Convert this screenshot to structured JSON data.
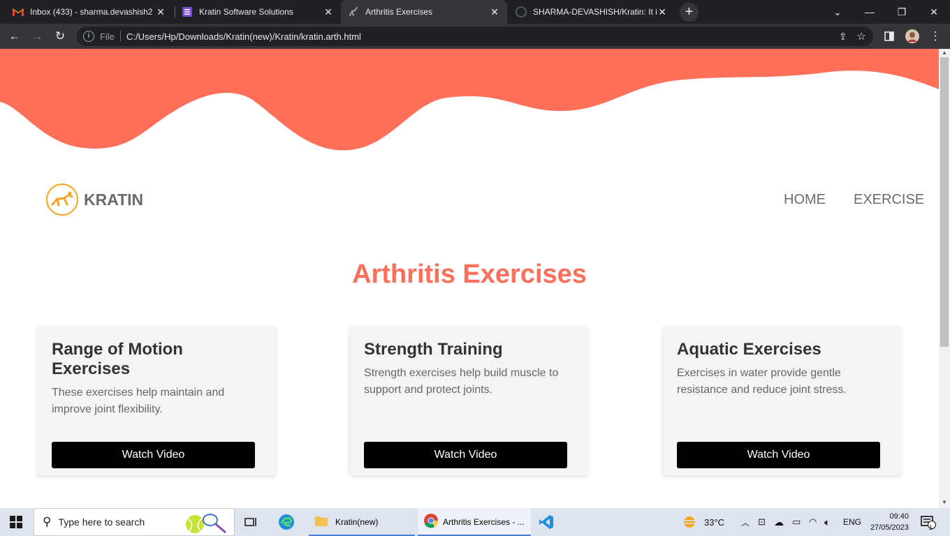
{
  "browser": {
    "tabs": [
      {
        "title": "Inbox (433) - sharma.devashish2",
        "icon": "gmail-icon"
      },
      {
        "title": "Kratin Software Solutions",
        "icon": "doc-icon"
      },
      {
        "title": "Arthritis Exercises",
        "icon": "exercise-icon",
        "active": true
      },
      {
        "title": "SHARMA-DEVASHISH/Kratin: It is",
        "icon": "github-icon"
      }
    ],
    "new_tab": "+",
    "omnibox": {
      "scheme_label": "File",
      "url": "C:/Users/Hp/Downloads/Kratin(new)/Kratin/kratin.arth.html"
    }
  },
  "site": {
    "logo_text": "KRATIN",
    "nav": {
      "home": "HOME",
      "exercise": "EXERCISE"
    },
    "title": "Arthritis Exercises",
    "accent_color": "#ff6f59",
    "cards": [
      {
        "title": "Range of Motion Exercises",
        "text": "These exercises help maintain and improve joint flexibility.",
        "button": "Watch Video"
      },
      {
        "title": "Strength Training",
        "text": "Strength exercises help build muscle to support and protect joints.",
        "button": "Watch Video"
      },
      {
        "title": "Aquatic Exercises",
        "text": "Exercises in water provide gentle resistance and reduce joint stress.",
        "button": "Watch Video"
      }
    ]
  },
  "taskbar": {
    "search_placeholder": "Type here to search",
    "apps": [
      {
        "label": "Kratin(new)",
        "icon": "folder-icon"
      },
      {
        "label": "Arthritis Exercises - ...",
        "icon": "chrome-icon"
      }
    ],
    "weather": "33°C",
    "language": "ENG",
    "time": "09:40",
    "date": "27/05/2023",
    "notification_count": "1"
  }
}
